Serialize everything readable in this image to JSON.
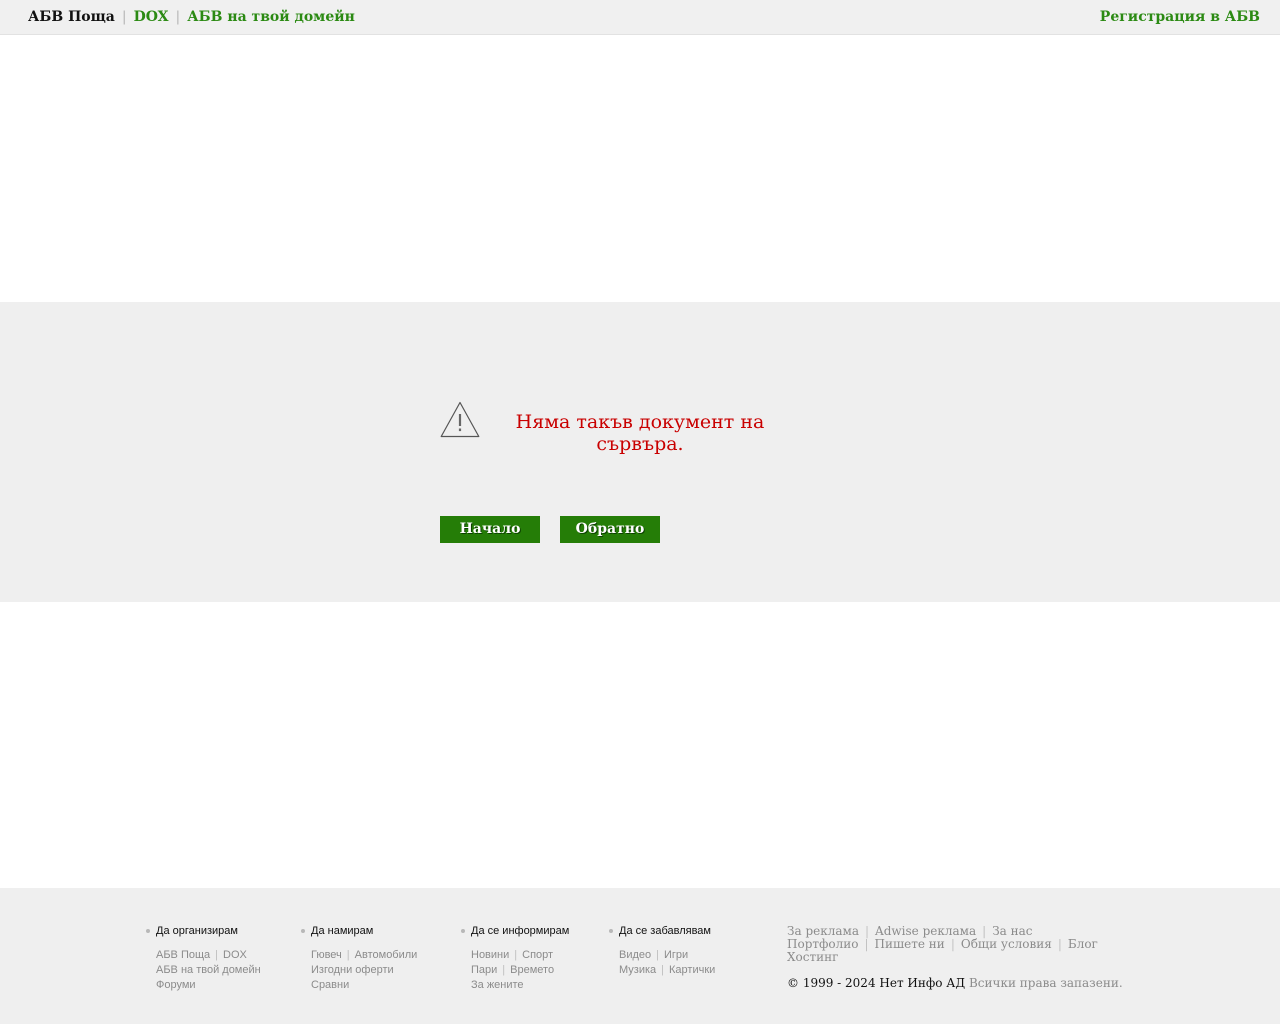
{
  "topbar": {
    "current": "АБВ Поща",
    "links": [
      "DOX",
      "АБВ на твой домейн"
    ],
    "register": "Регистрация в АБВ"
  },
  "error": {
    "icon": "warning-triangle-icon",
    "message": "Няма такъв документ на сървъра.",
    "home_button": "Начало",
    "back_button": "Обратно"
  },
  "footer": {
    "columns": [
      {
        "title": "Да организирам",
        "rows": [
          [
            "АБВ Поща",
            "DOX"
          ],
          [
            "АБВ на твой домейн"
          ],
          [
            "Форуми"
          ]
        ]
      },
      {
        "title": "Да намирам",
        "rows": [
          [
            "Гювеч",
            "Автомобили"
          ],
          [
            "Изгодни оферти"
          ],
          [
            "Сравни"
          ]
        ]
      },
      {
        "title": "Да се информирам",
        "rows": [
          [
            "Новини",
            "Спорт"
          ],
          [
            "Пари",
            "Времето"
          ],
          [
            "За жените"
          ]
        ]
      },
      {
        "title": "Да се забавлявам",
        "rows": [
          [
            "Видео",
            "Игри"
          ],
          [
            "Музика",
            "Картички"
          ]
        ]
      }
    ],
    "links": [
      "За реклама",
      "Adwise реклама",
      "За нас",
      "Портфолио",
      "Пишете ни",
      "Общи условия",
      "Блог",
      "Хостинг"
    ],
    "copyright_owner": "© 1999 - 2024 Нет Инфо АД",
    "copyright_rights": "Всички права запазени."
  },
  "colors": {
    "accent_green": "#2b8a13",
    "button_green": "#257d07",
    "error_red": "#c90000",
    "band_gray": "#efefef"
  }
}
